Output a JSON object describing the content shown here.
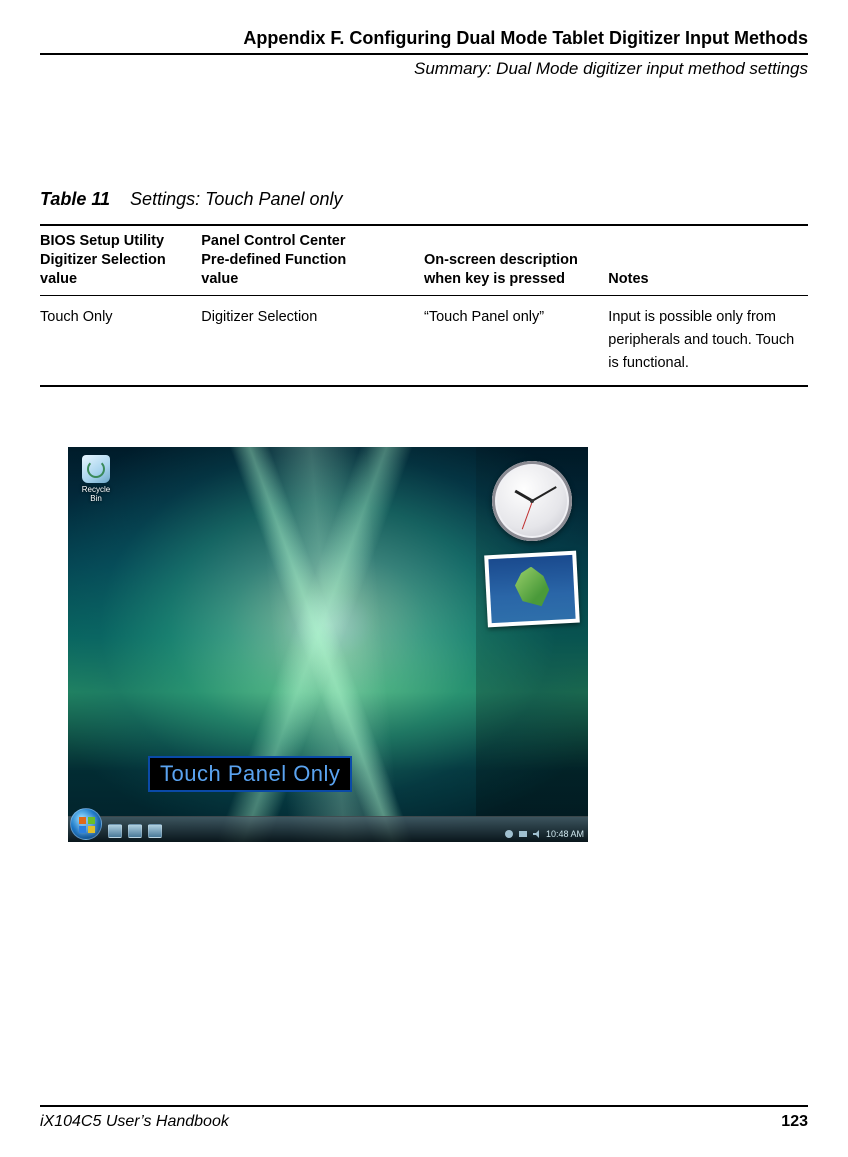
{
  "header": {
    "appendix": "Appendix F. Configuring Dual Mode Tablet Digitizer Input Methods",
    "summary": "Summary: Dual Mode digitizer input method settings"
  },
  "caption": {
    "label": "Table 11",
    "title": "Settings: Touch Panel only"
  },
  "table": {
    "headers": {
      "c1a": "BIOS Setup Utility",
      "c1b": "Digitizer Selection",
      "c1c": "value",
      "c2a": "Panel Control Center",
      "c2b": "Pre-defined Function",
      "c2c": "value",
      "c3a": "On-screen description",
      "c3b": "when key is pressed",
      "c4": "Notes"
    },
    "row": {
      "bios": "Touch Only",
      "pcc": "Digitizer Selection",
      "osd": "“Touch Panel only”",
      "notes": "Input is possible only from peripherals and touch. Touch is functional."
    }
  },
  "screenshot": {
    "recycle_label": "Recycle Bin",
    "overlay": "Touch Panel Only",
    "tray_time": "10:48 AM"
  },
  "footer": {
    "book": "iX104C5 User’s Handbook",
    "page": "123"
  }
}
